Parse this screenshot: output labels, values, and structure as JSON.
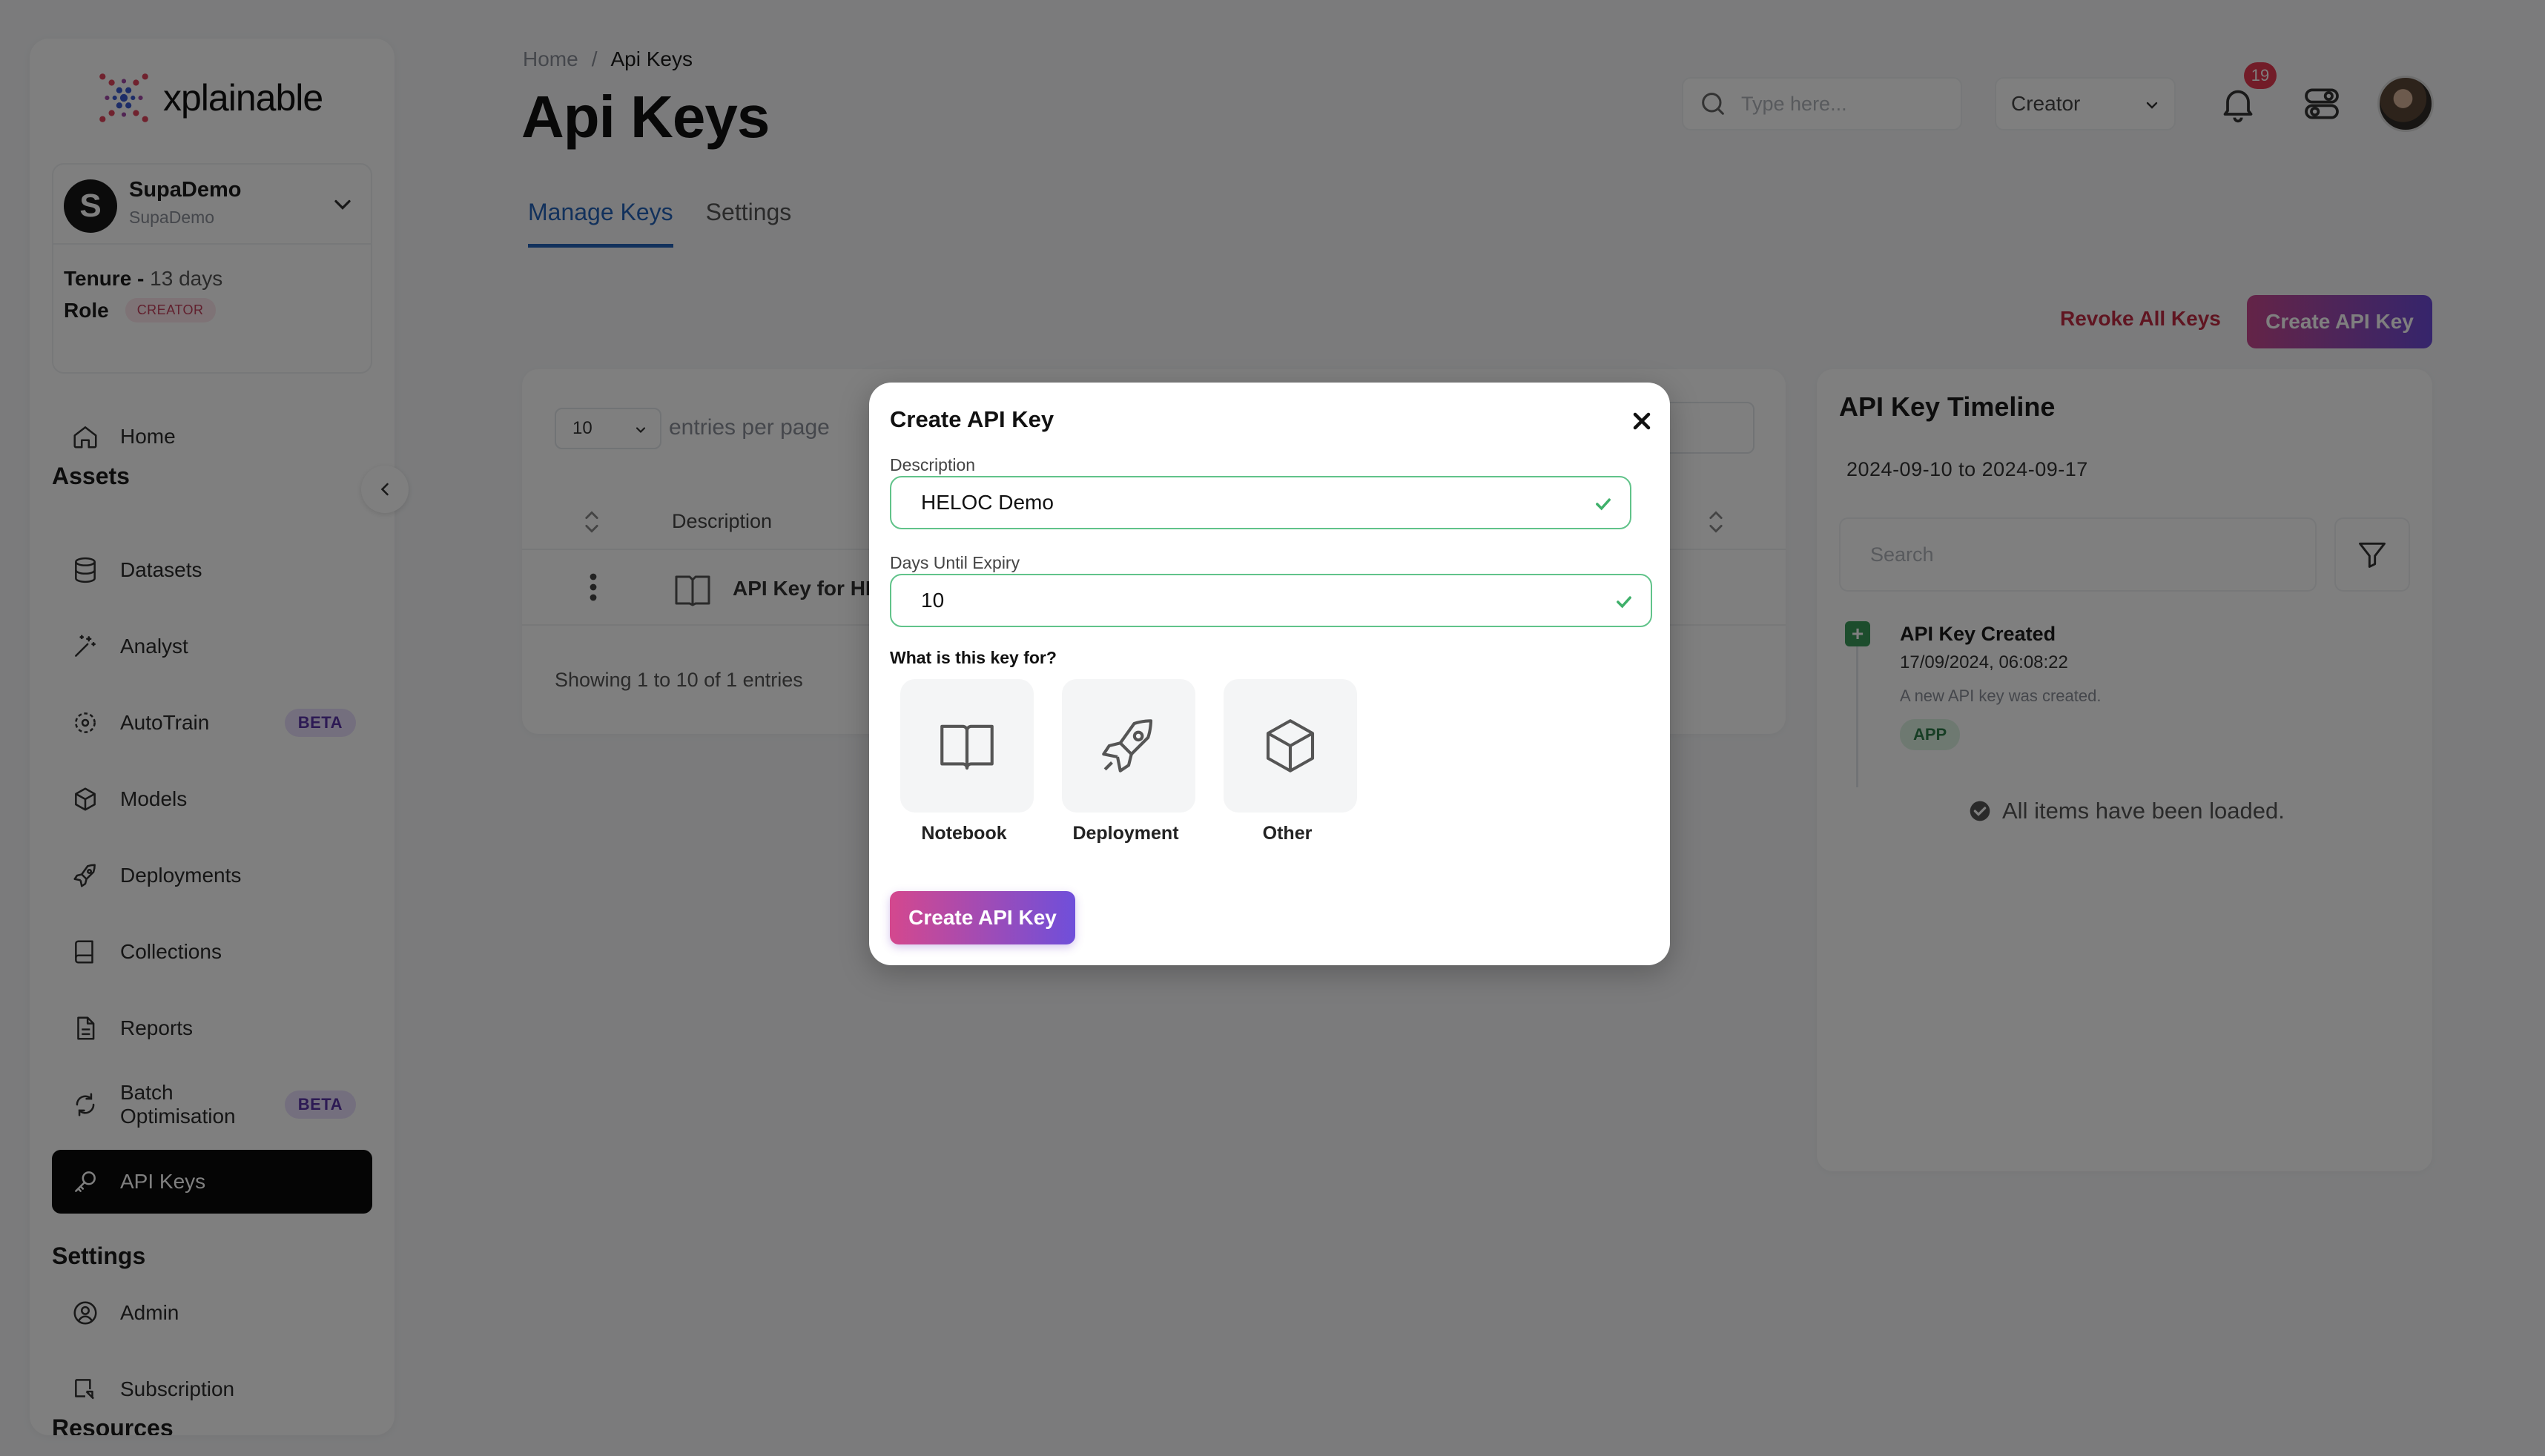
{
  "brand": {
    "name": "xplainable"
  },
  "account": {
    "initial": "S",
    "name": "SupaDemo",
    "subname": "SupaDemo",
    "tenure_label": "Tenure - ",
    "tenure_value": "13 days",
    "role_label": "Role",
    "role_badge": "CREATOR"
  },
  "sidebar": {
    "home": "Home",
    "assets_title": "Assets",
    "items": [
      {
        "label": "Datasets",
        "icon": "database-icon"
      },
      {
        "label": "Analyst",
        "icon": "magic-wand-icon"
      },
      {
        "label": "AutoTrain",
        "icon": "autotrain-icon",
        "badge": "BETA"
      },
      {
        "label": "Models",
        "icon": "cube-icon"
      },
      {
        "label": "Deployments",
        "icon": "rocket-icon"
      },
      {
        "label": "Collections",
        "icon": "book-icon"
      },
      {
        "label": "Reports",
        "icon": "document-icon"
      },
      {
        "label": "Batch Optimisation",
        "icon": "refresh-icon",
        "badge": "BETA"
      },
      {
        "label": "API Keys",
        "icon": "key-icon",
        "active": true
      }
    ],
    "settings_title": "Settings",
    "settings_items": [
      {
        "label": "Admin",
        "icon": "user-circle-icon"
      },
      {
        "label": "Subscription",
        "icon": "subscription-icon"
      }
    ],
    "resources_title": "Resources"
  },
  "header": {
    "breadcrumb_home": "Home",
    "breadcrumb_sep": "/",
    "breadcrumb_current": "Api Keys",
    "title": "Api Keys",
    "search_placeholder": "Type here...",
    "role_select": "Creator",
    "notification_count": "19"
  },
  "tabs": {
    "manage": "Manage Keys",
    "settings": "Settings"
  },
  "actions": {
    "revoke": "Revoke All Keys",
    "create": "Create API Key"
  },
  "table": {
    "per_page_value": "10",
    "per_page_label": "entries per page",
    "col_description": "Description",
    "rows": [
      {
        "description": "API Key for HEL"
      }
    ],
    "showing": "Showing 1 to 10 of 1 entries"
  },
  "timeline": {
    "title": "API Key Timeline",
    "range": "2024-09-10 to 2024-09-17",
    "search_placeholder": "Search",
    "events": [
      {
        "icon": "+",
        "title": "API Key Created",
        "time": "17/09/2024, 06:08:22",
        "desc": "A new API key was created.",
        "badge": "APP"
      }
    ],
    "loaded": "All items have been loaded."
  },
  "modal": {
    "title": "Create API Key",
    "description_label": "Description",
    "description_value": "HELOC Demo",
    "expiry_label": "Days Until Expiry",
    "expiry_value": "10",
    "purpose_label": "What is this key for?",
    "options": [
      {
        "label": "Notebook",
        "icon": "book-open-icon"
      },
      {
        "label": "Deployment",
        "icon": "rocket-icon"
      },
      {
        "label": "Other",
        "icon": "cube-icon"
      }
    ],
    "submit": "Create API Key"
  },
  "colors": {
    "accent_blue": "#2563b8",
    "gradient_start": "#d4488e",
    "gradient_end": "#6f4fda",
    "success": "#61c38a",
    "danger": "#c02b42"
  }
}
